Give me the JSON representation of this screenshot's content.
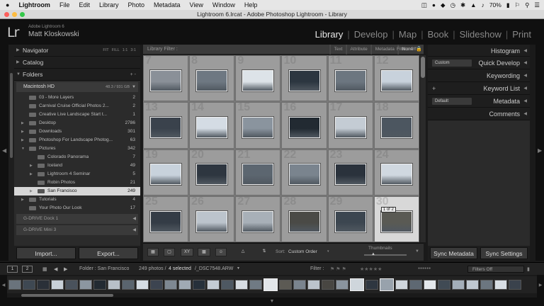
{
  "menubar": {
    "apple": "",
    "app": "Lightroom",
    "items": [
      "File",
      "Edit",
      "Library",
      "Photo",
      "Metadata",
      "View",
      "Window",
      "Help"
    ],
    "battery": "70%"
  },
  "window": {
    "title": "Lightroom 6.lrcat - Adobe Photoshop Lightroom - Library"
  },
  "identity": {
    "logo": "Lr",
    "product": "Adobe Lightroom 6",
    "user": "Matt Kloskowski"
  },
  "modules": [
    "Library",
    "Develop",
    "Map",
    "Book",
    "Slideshow",
    "Print"
  ],
  "active_module": "Library",
  "left_panel": {
    "navigator": "Navigator",
    "nav_opts": [
      "FIT",
      "FILL",
      "1:1",
      "3:1"
    ],
    "catalog": "Catalog",
    "folders": "Folders",
    "folders_icons": "+ -",
    "volume": {
      "name": "Macintosh HD",
      "info": "48.3 / 931 GB"
    },
    "folders_list": [
      {
        "name": "03 - More Layers",
        "count": "2",
        "indent": 0,
        "arrow": ""
      },
      {
        "name": "Carnival Cruise Official Photos 2...",
        "count": "2",
        "indent": 0,
        "arrow": ""
      },
      {
        "name": "Creative Live Landscape Start t...",
        "count": "1",
        "indent": 0,
        "arrow": ""
      },
      {
        "name": "Desktop",
        "count": "2786",
        "indent": 0,
        "arrow": "▶"
      },
      {
        "name": "Downloads",
        "count": "301",
        "indent": 0,
        "arrow": "▶"
      },
      {
        "name": "Photoshop For Landscape Photog...",
        "count": "63",
        "indent": 0,
        "arrow": "▶"
      },
      {
        "name": "Pictures",
        "count": "342",
        "indent": 0,
        "arrow": "▼"
      },
      {
        "name": "Colorado Panorama",
        "count": "7",
        "indent": 1,
        "arrow": ""
      },
      {
        "name": "Iceland",
        "count": "49",
        "indent": 1,
        "arrow": "▶"
      },
      {
        "name": "Lightroom 4 Seminar",
        "count": "5",
        "indent": 1,
        "arrow": "▶"
      },
      {
        "name": "Robin Photos",
        "count": "21",
        "indent": 1,
        "arrow": ""
      },
      {
        "name": "San Francisco",
        "count": "249",
        "indent": 1,
        "arrow": "▶",
        "selected": true
      },
      {
        "name": "Tutorials",
        "count": "4",
        "indent": 0,
        "arrow": "▶"
      },
      {
        "name": "Your Photo Our Look",
        "count": "17",
        "indent": 0,
        "arrow": ""
      }
    ],
    "drives": [
      "G-DRIVE Dock 1",
      "G-DRIVE Mini 3"
    ],
    "import": "Import...",
    "export": "Export..."
  },
  "filter_bar": {
    "label": "Library Filter :",
    "options": [
      "Text",
      "Attribute",
      "Metadata",
      "None"
    ],
    "active": "None",
    "filters_off": "Filters Off"
  },
  "grid": {
    "cells": [
      {
        "num": "7",
        "tone": "#8a9098"
      },
      {
        "num": "8",
        "tone": "#6e7882"
      },
      {
        "num": "9",
        "tone": "#dde3e8"
      },
      {
        "num": "10",
        "tone": "#2c3640"
      },
      {
        "num": "11",
        "tone": "#6c7680"
      },
      {
        "num": "12",
        "tone": "#c8d2dc"
      },
      {
        "num": "13",
        "tone": "#3a424c"
      },
      {
        "num": "14",
        "tone": "#d4dce4"
      },
      {
        "num": "15",
        "tone": "#8a949e"
      },
      {
        "num": "16",
        "tone": "#222a32"
      },
      {
        "num": "17",
        "tone": "#c4ccd4"
      },
      {
        "num": "18",
        "tone": "#4c5660"
      },
      {
        "num": "19",
        "tone": "#c8d2dc"
      },
      {
        "num": "20",
        "tone": "#2e3640"
      },
      {
        "num": "21",
        "tone": "#5c6670"
      },
      {
        "num": "22",
        "tone": "#7a848e"
      },
      {
        "num": "23",
        "tone": "#2a323c"
      },
      {
        "num": "24",
        "tone": "#d0d8e0"
      },
      {
        "num": "25",
        "tone": "#343c46"
      },
      {
        "num": "26",
        "tone": "#bcc4cc"
      },
      {
        "num": "27",
        "tone": "#a8b0b8"
      },
      {
        "num": "28",
        "tone": "#4a4a46"
      },
      {
        "num": "29",
        "tone": "#3c4650"
      },
      {
        "num": "30",
        "tone": "#5a5a54",
        "selected": true
      }
    ],
    "stack_badge": "1 of 2"
  },
  "toolbar": {
    "sort_label": "Sort:",
    "sort_value": "Custom Order",
    "thumbnails_label": "Thumbnails"
  },
  "right_panel": {
    "histogram": "Histogram",
    "quick_develop": "Quick Develop",
    "qd_preset": "Custom",
    "keywording": "Keywording",
    "keyword_list": "Keyword List",
    "metadata": "Metadata",
    "md_preset": "Default",
    "comments": "Comments",
    "sync_metadata": "Sync Metadata",
    "sync_settings": "Sync Settings"
  },
  "filmstrip_bar": {
    "screen1": "1",
    "screen2": "2",
    "folder": "Folder : San Francisco",
    "count_pre": "249 photos /",
    "selected_text": "4 selected",
    "file": "/_DSC7548.ARW",
    "filter_label": "Filter :",
    "filter_value": "Filters Off"
  },
  "filmstrip": {
    "tones": [
      "#6a737c",
      "#3e4852",
      "#2a3038",
      "#c8d0d8",
      "#4a525c",
      "#8c96a0",
      "#222a32",
      "#b8c0c8",
      "#5a646e",
      "#d6dde4",
      "#3c4450",
      "#7e8892",
      "#a0aab4",
      "#26303a",
      "#c4ccd4",
      "#4e5862",
      "#d8dde2",
      "#707a84",
      "#e2e6ea",
      "#5c5a54",
      "#7a848e",
      "#bcc4cc",
      "#484642",
      "#8a949e",
      "#cfd6dc",
      "#2e3640",
      "#98a2ac",
      "#d0d6dc",
      "#5e6872",
      "#e4e8ec",
      "#404a54",
      "#a4aeb8",
      "#c0c8d0",
      "#6c7680",
      "#d8dee4",
      "#3a424c"
    ],
    "selected_indices": [
      18,
      24,
      26
    ]
  },
  "colors": {
    "accent": "#e8e8e8",
    "panel": "#2b2b2b",
    "grid_bg": "#9c9c9c"
  }
}
